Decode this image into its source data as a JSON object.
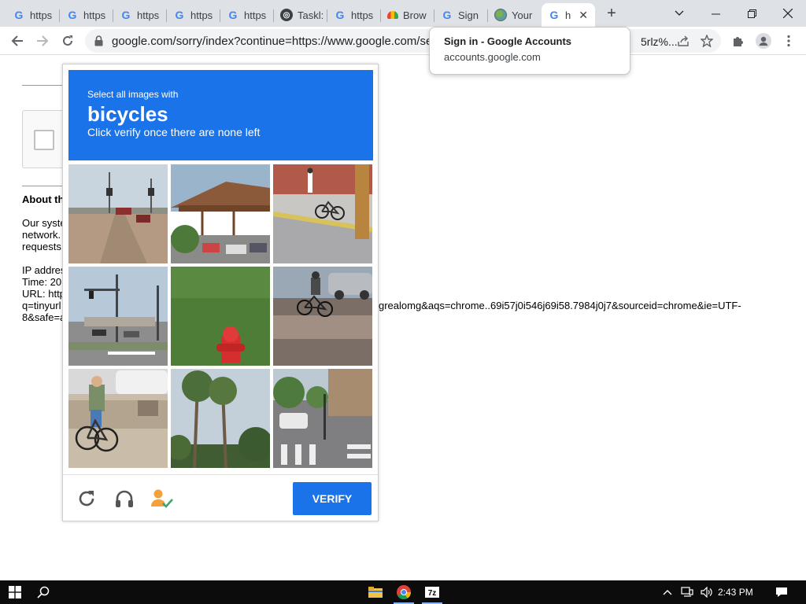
{
  "browser": {
    "tabs": [
      {
        "label": "https",
        "favicon": "google-g-icon"
      },
      {
        "label": "https",
        "favicon": "google-g-icon"
      },
      {
        "label": "https",
        "favicon": "google-g-icon"
      },
      {
        "label": "https",
        "favicon": "google-g-icon"
      },
      {
        "label": "https",
        "favicon": "google-g-icon"
      },
      {
        "label": "Taskl:",
        "favicon": "chatgpt-icon"
      },
      {
        "label": "https",
        "favicon": "google-g-icon"
      },
      {
        "label": "Brow",
        "favicon": "rainbow-icon"
      },
      {
        "label": "Sign",
        "favicon": "google-g-icon"
      },
      {
        "label": "Your",
        "favicon": "globe-icon"
      },
      {
        "label": "h",
        "favicon": "google-g-icon",
        "active": true
      }
    ],
    "address": "google.com/sorry/index?continue=https://www.google.com/searc",
    "address_tail": "5rlz%..."
  },
  "hovercard": {
    "title": "Sign in - Google Accounts",
    "subtitle": "accounts.google.com"
  },
  "page": {
    "about_heading": "About th",
    "lines": [
      "Our syste",
      "network.",
      "requests"
    ],
    "ip_line": "IP addres",
    "time_line": "Time: 20",
    "url_line": "URL: http",
    "q_line": "q=tinyurl",
    "safe_line": "8&safe=a",
    "url_tail_1": "grealomg&aqs=chrome..69i57j0i546j69i58.7984j0j7&sourceid=chrome&ie=UTF-"
  },
  "captcha": {
    "instruction": "Select all images with",
    "target": "bicycles",
    "hint": "Click verify once there are none left",
    "verify_label": "VERIFY",
    "tiles": [
      {
        "name": "tile-street-traffic-lights",
        "has_bicycle": false
      },
      {
        "name": "tile-pavilion-parking",
        "has_bicycle": false
      },
      {
        "name": "tile-person-with-bicycle-sidewalk",
        "has_bicycle": true
      },
      {
        "name": "tile-intersection-traffic-lights",
        "has_bicycle": false
      },
      {
        "name": "tile-fire-hydrant-grass",
        "has_bicycle": false
      },
      {
        "name": "tile-cyclist-on-street",
        "has_bicycle": true
      },
      {
        "name": "tile-cyclist-riding-bicycle",
        "has_bicycle": true
      },
      {
        "name": "tile-palm-trees",
        "has_bicycle": false
      },
      {
        "name": "tile-crosswalk-street",
        "has_bicycle": false
      }
    ]
  },
  "taskbar": {
    "time": "2:43 PM",
    "apps": [
      "file-explorer-icon",
      "chrome-icon",
      "7zip-icon"
    ]
  },
  "colors": {
    "accent": "#1a73e8",
    "tabstrip": "#dee1e6"
  }
}
